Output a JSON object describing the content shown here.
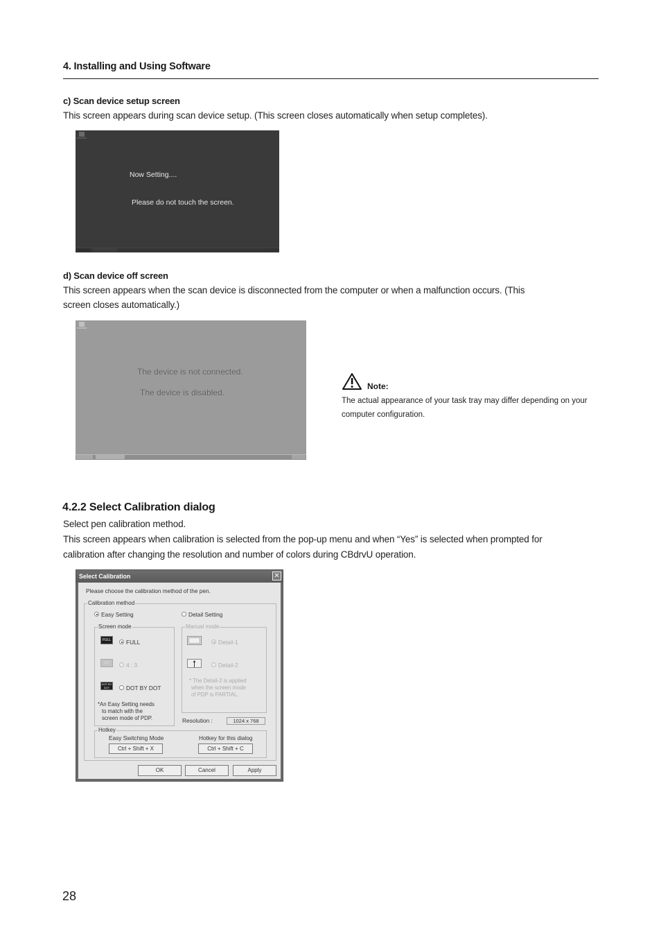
{
  "header": {
    "title": "4. Installing and Using Software"
  },
  "section_c": {
    "heading": "c)  Scan device setup screen",
    "description": "This screen appears during scan device setup. (This screen closes automatically when setup completes).",
    "screenshot": {
      "line1": "Now Setting....",
      "line2": "Please do not touch the screen."
    }
  },
  "section_d": {
    "heading": "d) Scan device off screen",
    "description_line1": "This screen appears when the scan device is disconnected from the computer or when a malfunction occurs. (This",
    "description_line2": "screen closes automatically.)",
    "screenshot": {
      "line1": "The device is not connected.",
      "line2": "The device is disabled."
    }
  },
  "note": {
    "icon": "warning-icon",
    "label": "Note:",
    "text": "The actual appearance of your task tray may differ depending on your computer configuration."
  },
  "section_422": {
    "title": "4.2.2  Select Calibration dialog",
    "line1": "Select pen calibration method.",
    "line2": "This screen appears when calibration is selected from the pop-up menu and when “Yes” is selected when prompted for",
    "line3": "calibration after changing the resolution and number of colors during CBdrvU operation."
  },
  "dialog": {
    "title": "Select Calibration",
    "close_icon": "close-icon",
    "prompt": "Please choose the calibration method of the pen.",
    "calibration_method": {
      "label": "Calibration method",
      "easy_setting": {
        "label": "Easy Setting",
        "selected": true
      },
      "detail_setting": {
        "label": "Detail Setting",
        "selected": false
      }
    },
    "screen_mode": {
      "label": "Screen mode",
      "options": [
        {
          "icon_text": "FULL",
          "label": "FULL",
          "selected": true,
          "enabled": true
        },
        {
          "icon_text": "4:3",
          "label": "4 : 3",
          "selected": false,
          "enabled": false
        },
        {
          "icon_text": "DOT BY DOT",
          "label": "DOT BY DOT",
          "selected": false,
          "enabled": true
        }
      ],
      "note_line1": "*An Easy Setting needs",
      "note_line2": "to match with the",
      "note_line3": "screen mode of PDP."
    },
    "manual_mode": {
      "label": "Manual mode",
      "options": [
        {
          "label": "Detail-1",
          "selected": true,
          "enabled": false
        },
        {
          "label": "Detail-2",
          "selected": false,
          "enabled": false
        }
      ],
      "note_line1": "* The Detail-2 is applied",
      "note_line2": "when the screen mode",
      "note_line3": "of PDP is PARTIAL."
    },
    "resolution": {
      "label": "Resolution :",
      "value": "1024 x 768"
    },
    "hotkey": {
      "label": "Hotkey",
      "easy_switching_label": "Easy Switching Mode",
      "easy_switching_value": "Ctrl + Shift + X",
      "dialog_hotkey_label": "Hotkey for this dialog",
      "dialog_hotkey_value": "Ctrl + Shift + C"
    },
    "buttons": {
      "ok": "OK",
      "cancel": "Cancel",
      "apply": "Apply"
    }
  },
  "page_number": "28"
}
